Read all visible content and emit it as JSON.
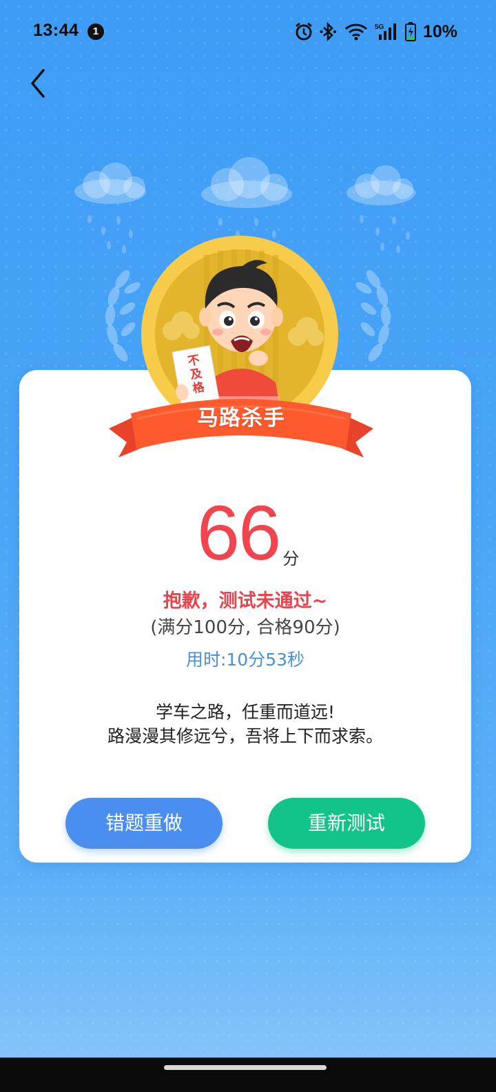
{
  "status_bar": {
    "time": "13:44",
    "notification_count": "1",
    "battery": "10%",
    "icons": [
      "alarm-icon",
      "bluetooth-icon",
      "wifi-icon",
      "5g-signal-icon",
      "battery-charging-icon"
    ]
  },
  "nav": {
    "back_icon": "chevron-left-icon"
  },
  "result": {
    "badge_title": "马路杀手",
    "paper_text": "不及格",
    "score": "66",
    "score_unit": "分",
    "fail_message": "抱歉，测试未通过~",
    "rules": "(满分100分, 合格90分)",
    "time_used": "用时:10分53秒",
    "motto_line1": "学车之路，任重而道远!",
    "motto_line2": "路漫漫其修远兮，吾将上下而求索。"
  },
  "actions": {
    "redo_wrong_label": "错题重做",
    "retest_label": "重新测试"
  },
  "colors": {
    "background": "#3e9cf6",
    "score_red": "#f0454e",
    "redo_button": "#4a8ff0",
    "retest_button": "#12c48a",
    "ribbon": "#ff5a2e",
    "medal_gold": "#f5c23d"
  }
}
